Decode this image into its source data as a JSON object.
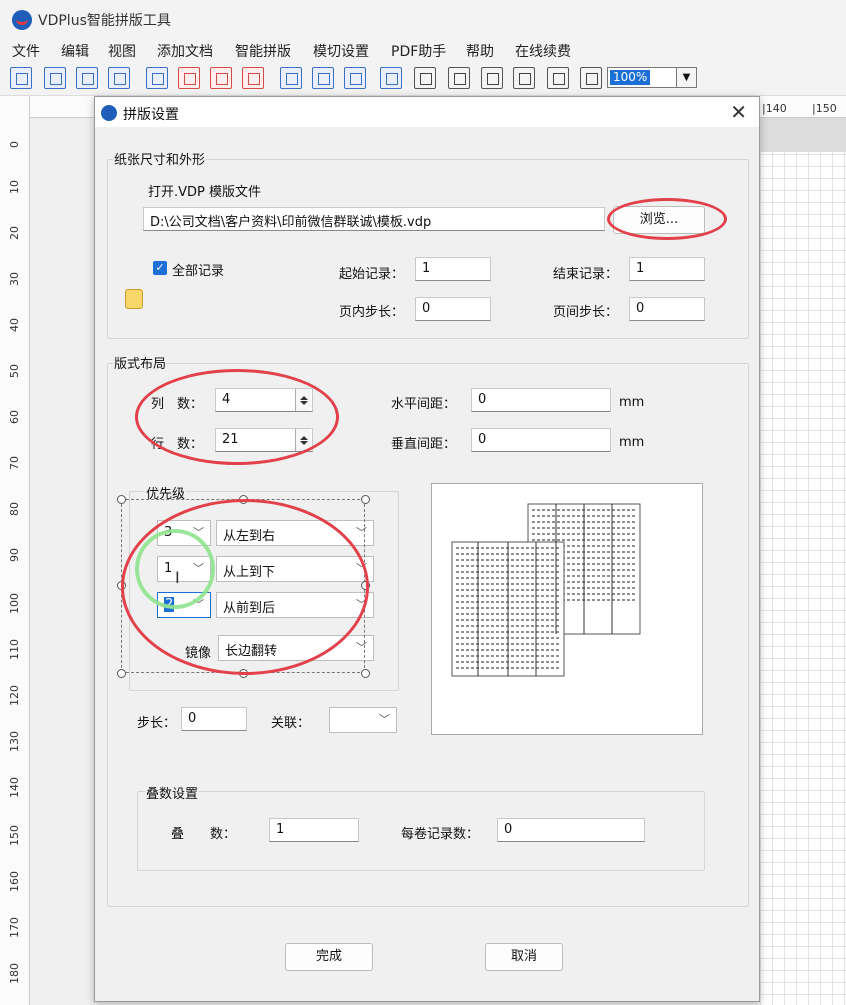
{
  "app": {
    "title": "VDPlus智能拼版工具"
  },
  "menu": [
    "文件",
    "编辑",
    "视图",
    "添加文档",
    "智能拼版",
    "模切设置",
    "PDF助手",
    "帮助",
    "在线续费"
  ],
  "toolbar": {
    "zoom": "100%"
  },
  "ruler_left": [
    "0",
    "10",
    "20",
    "30",
    "40",
    "50",
    "60",
    "70",
    "80",
    "90",
    "100",
    "110",
    "120",
    "130",
    "140",
    "150",
    "160",
    "170",
    "180"
  ],
  "ruler_top": [
    "|140",
    "|150"
  ],
  "dialog": {
    "title": "拼版设置",
    "paper_group": {
      "label": "纸张尺寸和外形",
      "open_label": "打开.VDP 模版文件",
      "path": "D:\\公司文档\\客户资料\\印前微信群联诚\\模板.vdp",
      "browse": "浏览...",
      "all_records": "全部记录",
      "start_label": "起始记录：",
      "start_value": "1",
      "end_label": "结束记录：",
      "end_value": "1",
      "inpage_step_label": "页内步长：",
      "inpage_step_value": "0",
      "interpage_step_label": "页间步长：",
      "interpage_step_value": "0"
    },
    "layout_group": {
      "label": "版式布局",
      "cols_label": "列　数：",
      "cols_value": "4",
      "rows_label": "行　数：",
      "rows_value": "21",
      "hgap_label": "水平间距：",
      "hgap_value": "0",
      "vgap_label": "垂直间距：",
      "vgap_value": "0",
      "unit": "mm",
      "priority_label": "优先级",
      "priority_rows": [
        {
          "num": "3",
          "dir": "从左到右"
        },
        {
          "num": "1",
          "dir": "从上到下"
        },
        {
          "num": "2",
          "dir": "从前到后"
        }
      ],
      "mirror_label": "镜像",
      "mirror_value": "长边翻转",
      "step_label": "步长：",
      "step_value": "0",
      "link_label": "关联："
    },
    "stack_group": {
      "label": "叠数设置",
      "stack_label": "叠　　数：",
      "stack_value": "1",
      "per_roll_label": "每卷记录数：",
      "per_roll_value": "0"
    },
    "finish": "完成",
    "cancel": "取消"
  }
}
